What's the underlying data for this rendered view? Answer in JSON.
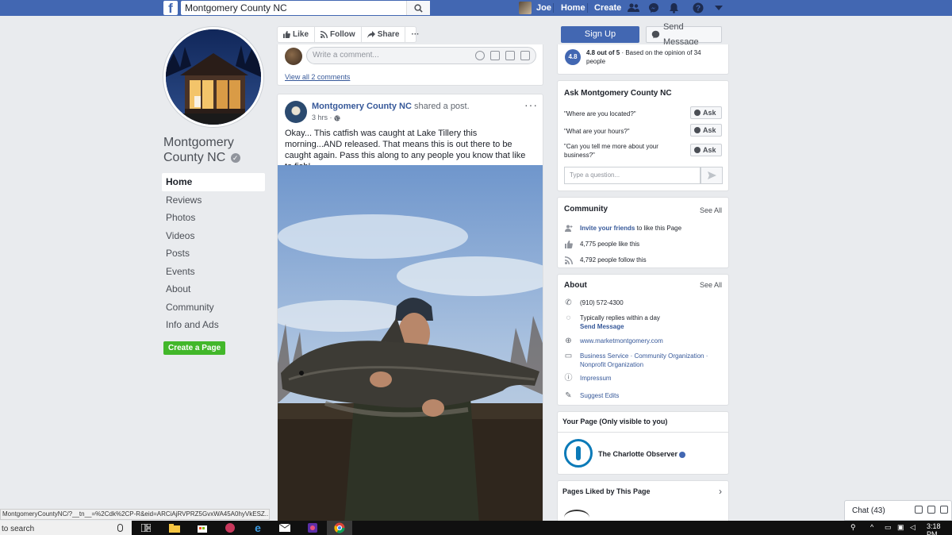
{
  "topbar": {
    "search_value": "Montgomery County NC",
    "user_name": "Joe",
    "home_label": "Home",
    "create_label": "Create"
  },
  "page": {
    "name_line1": "Montgomery",
    "name_line2": "County NC"
  },
  "left_nav": [
    {
      "label": "Home",
      "active": true
    },
    {
      "label": "Reviews"
    },
    {
      "label": "Photos"
    },
    {
      "label": "Videos"
    },
    {
      "label": "Posts"
    },
    {
      "label": "Events"
    },
    {
      "label": "About"
    },
    {
      "label": "Community"
    },
    {
      "label": "Info and Ads"
    }
  ],
  "create_page_label": "Create a Page",
  "action_bar": {
    "like": "Like",
    "follow": "Follow",
    "share": "Share",
    "more": "···"
  },
  "comment_box": {
    "placeholder": "Write a comment...",
    "view_all": "View all 2 comments"
  },
  "post": {
    "author": "Montgomery County NC",
    "action": "shared a post.",
    "time": "3 hrs",
    "more": "···",
    "text": "Okay... This catfish was caught at Lake Tillery this morning...AND released. That means this is out there to be caught again. Pass this along to any people you know that like to fish!"
  },
  "right": {
    "signup_label": "Sign Up",
    "send_message_label": "Send Message",
    "rating": {
      "badge": "4.8",
      "score": "4.8 out of 5",
      "sep": " · ",
      "detail": "Based on the opinion of 34 people"
    },
    "ask": {
      "title": "Ask Montgomery County NC",
      "questions": [
        {
          "q": "\"Where are you located?\"",
          "btn": "Ask"
        },
        {
          "q": "\"What are your hours?\"",
          "btn": "Ask"
        },
        {
          "q": "\"Can you tell me more about your business?\"",
          "btn": "Ask"
        }
      ],
      "input_placeholder": "Type a question..."
    },
    "community": {
      "title": "Community",
      "see_all": "See All",
      "invite_link": "Invite your friends",
      "invite_rest": "to like this Page",
      "likes": "4,775 people like this",
      "follows": "4,792 people follow this"
    },
    "about": {
      "title": "About",
      "see_all": "See All",
      "phone": "(910) 572-4300",
      "replies": "Typically replies within a day",
      "send_message": "Send Message",
      "website": "www.marketmontgomery.com",
      "categories": "Business Service · Community Organization · Nonprofit Organization",
      "impressum": "Impressum",
      "suggest": "Suggest Edits"
    },
    "your_page": {
      "title": "Your Page (Only visible to you)",
      "name": "The Charlotte Observer"
    },
    "pages_liked": {
      "title": "Pages Liked by This Page"
    }
  },
  "chat": {
    "label": "Chat (43)"
  },
  "status_url": "MontgomeryCountyNC/?__tn__=%2Cdk%2CP-R&eid=ARCiAjRVPRZ5GvxWA45A0hyVkESZ...",
  "taskbar": {
    "search_text": "to search",
    "time": "3:18 PM"
  },
  "colors": {
    "fb_blue": "#4267b2",
    "link_blue": "#365899",
    "green": "#42b72a",
    "page_bg": "#e9ebee"
  }
}
